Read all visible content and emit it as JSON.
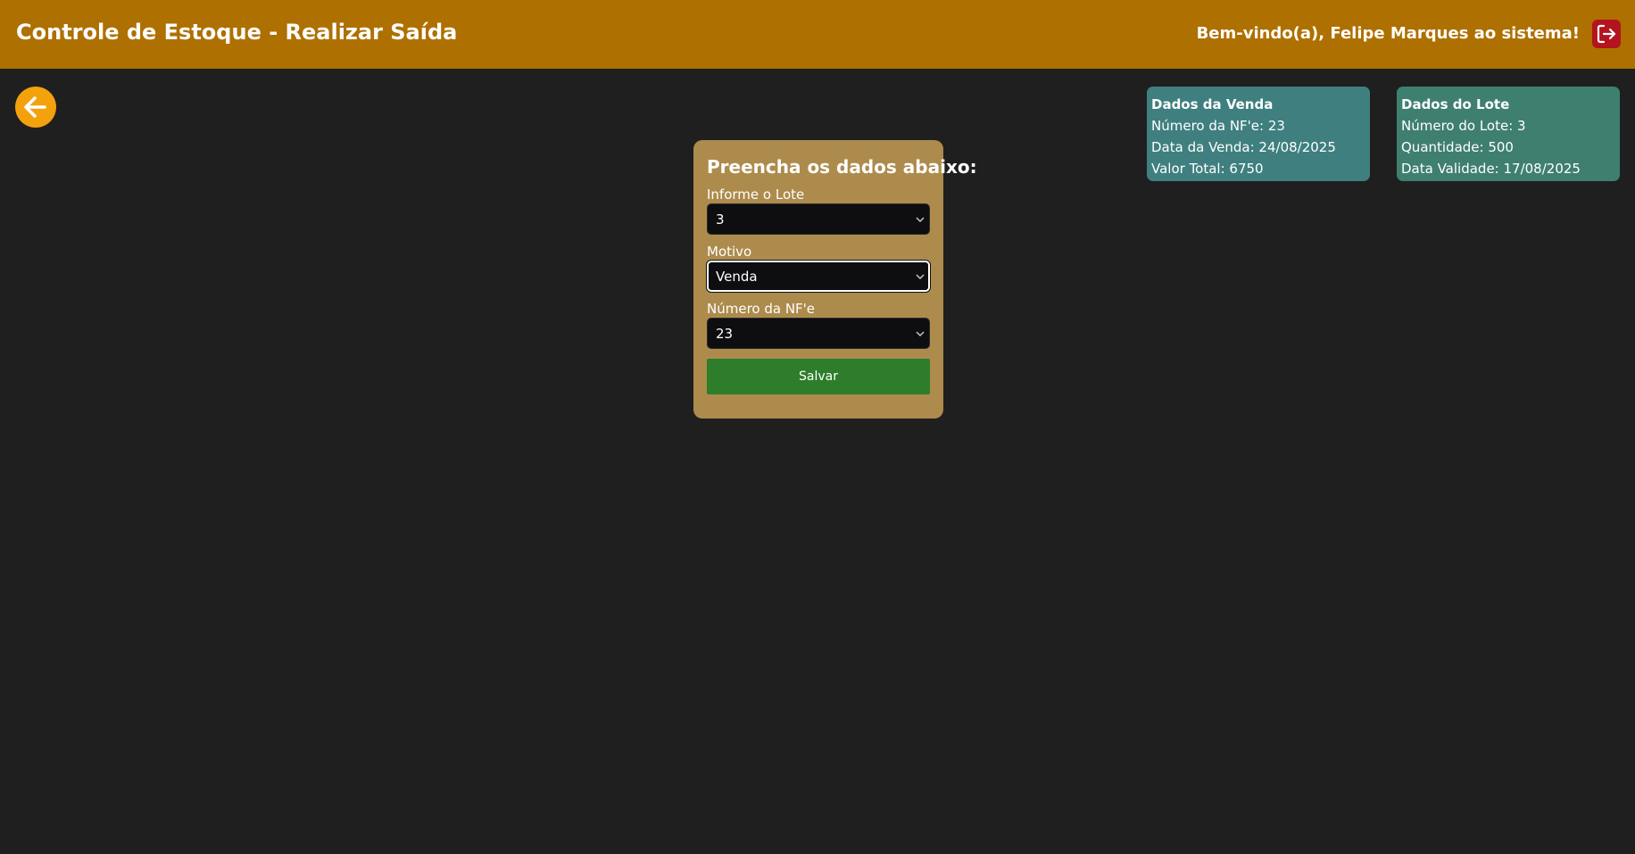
{
  "header": {
    "title": "Controle de Estoque - Realizar Saída",
    "welcome": "Bem-vindo(a), Felipe Marques ao sistema!",
    "logout_icon": "logout-icon"
  },
  "back_button": {
    "icon": "arrow-left-icon"
  },
  "venda_card": {
    "title": "Dados da Venda",
    "nfe": "Número da NF'e: 23",
    "data": "Data da Venda: 24/08/2025",
    "valor": "Valor Total: 6750"
  },
  "lote_card": {
    "title": "Dados do Lote",
    "numero": "Número do Lote: 3",
    "quantidade": "Quantidade: 500",
    "validade": "Data Validade: 17/08/2025"
  },
  "form": {
    "title": "Preencha os dados abaixo:",
    "lote_label": "Informe o Lote",
    "lote_value": "3",
    "motivo_label": "Motivo",
    "motivo_value": "Venda",
    "nfe_label": "Número da NF'e",
    "nfe_value": "23",
    "save_label": "Salvar"
  },
  "colors": {
    "header_bg": "#ae7000",
    "page_bg": "#1f1f1f",
    "form_bg": "#ad8b4c",
    "save_button": "#2e7d2b",
    "logout_button": "#b3141e",
    "back_button": "#f3a20e",
    "venda_card": "#3f7f7f",
    "lote_card": "#3f7f6f"
  }
}
